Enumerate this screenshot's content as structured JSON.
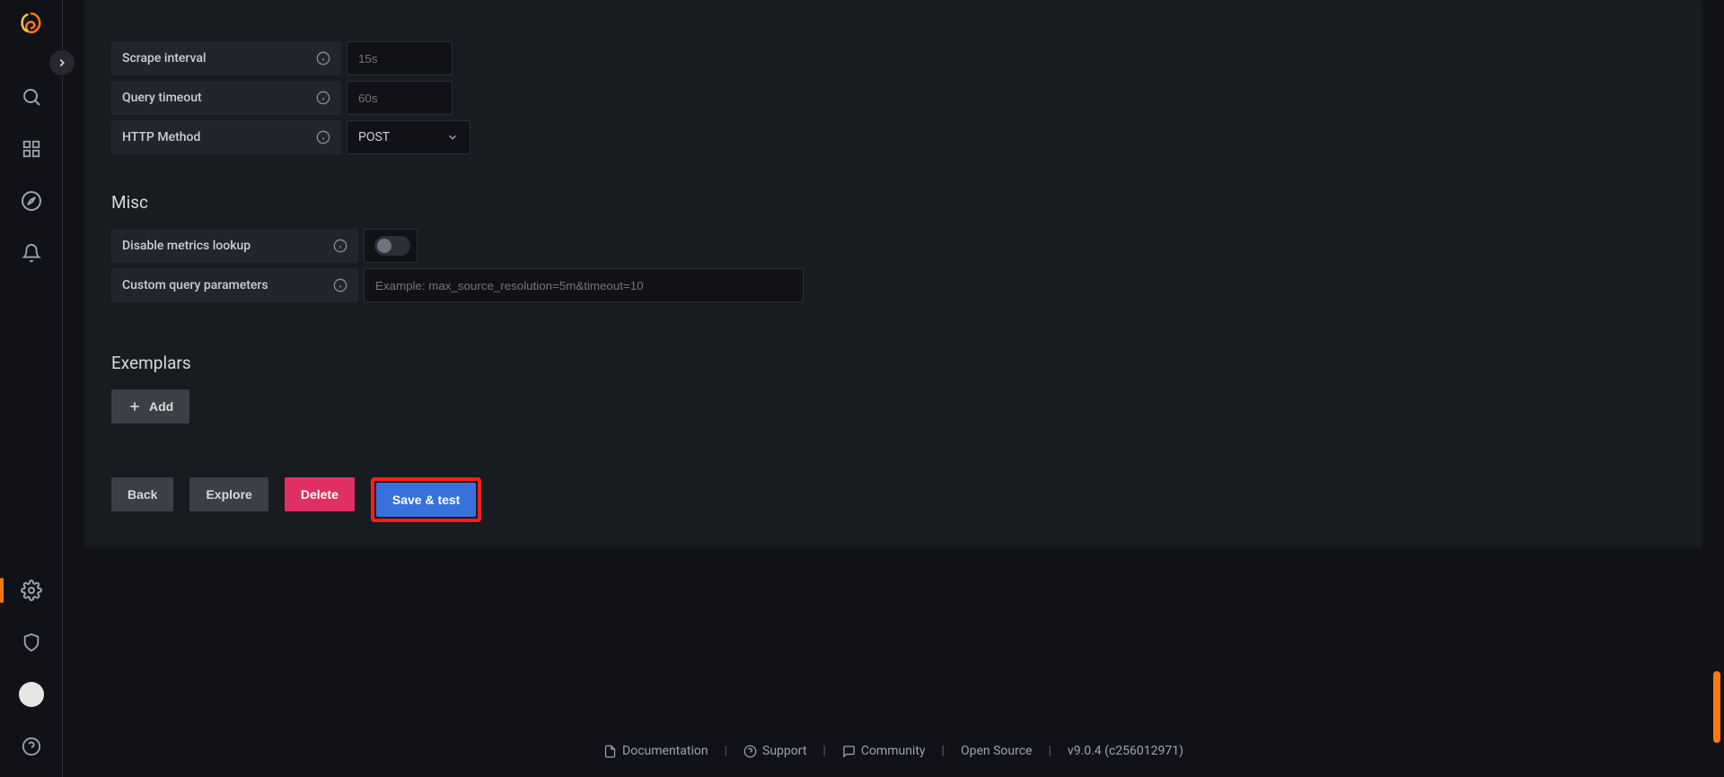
{
  "form": {
    "scrape_interval": {
      "label": "Scrape interval",
      "placeholder": "15s"
    },
    "query_timeout": {
      "label": "Query timeout",
      "placeholder": "60s"
    },
    "http_method": {
      "label": "HTTP Method",
      "selected": "POST"
    }
  },
  "misc": {
    "heading": "Misc",
    "disable_metrics": {
      "label": "Disable metrics lookup"
    },
    "custom_params": {
      "label": "Custom query parameters",
      "placeholder": "Example: max_source_resolution=5m&timeout=10"
    }
  },
  "exemplars": {
    "heading": "Exemplars",
    "add_label": "Add"
  },
  "actions": {
    "back": "Back",
    "explore": "Explore",
    "delete": "Delete",
    "save_test": "Save & test"
  },
  "footer": {
    "documentation": "Documentation",
    "support": "Support",
    "community": "Community",
    "open_source": "Open Source",
    "version": "v9.0.4 (c256012971)"
  }
}
